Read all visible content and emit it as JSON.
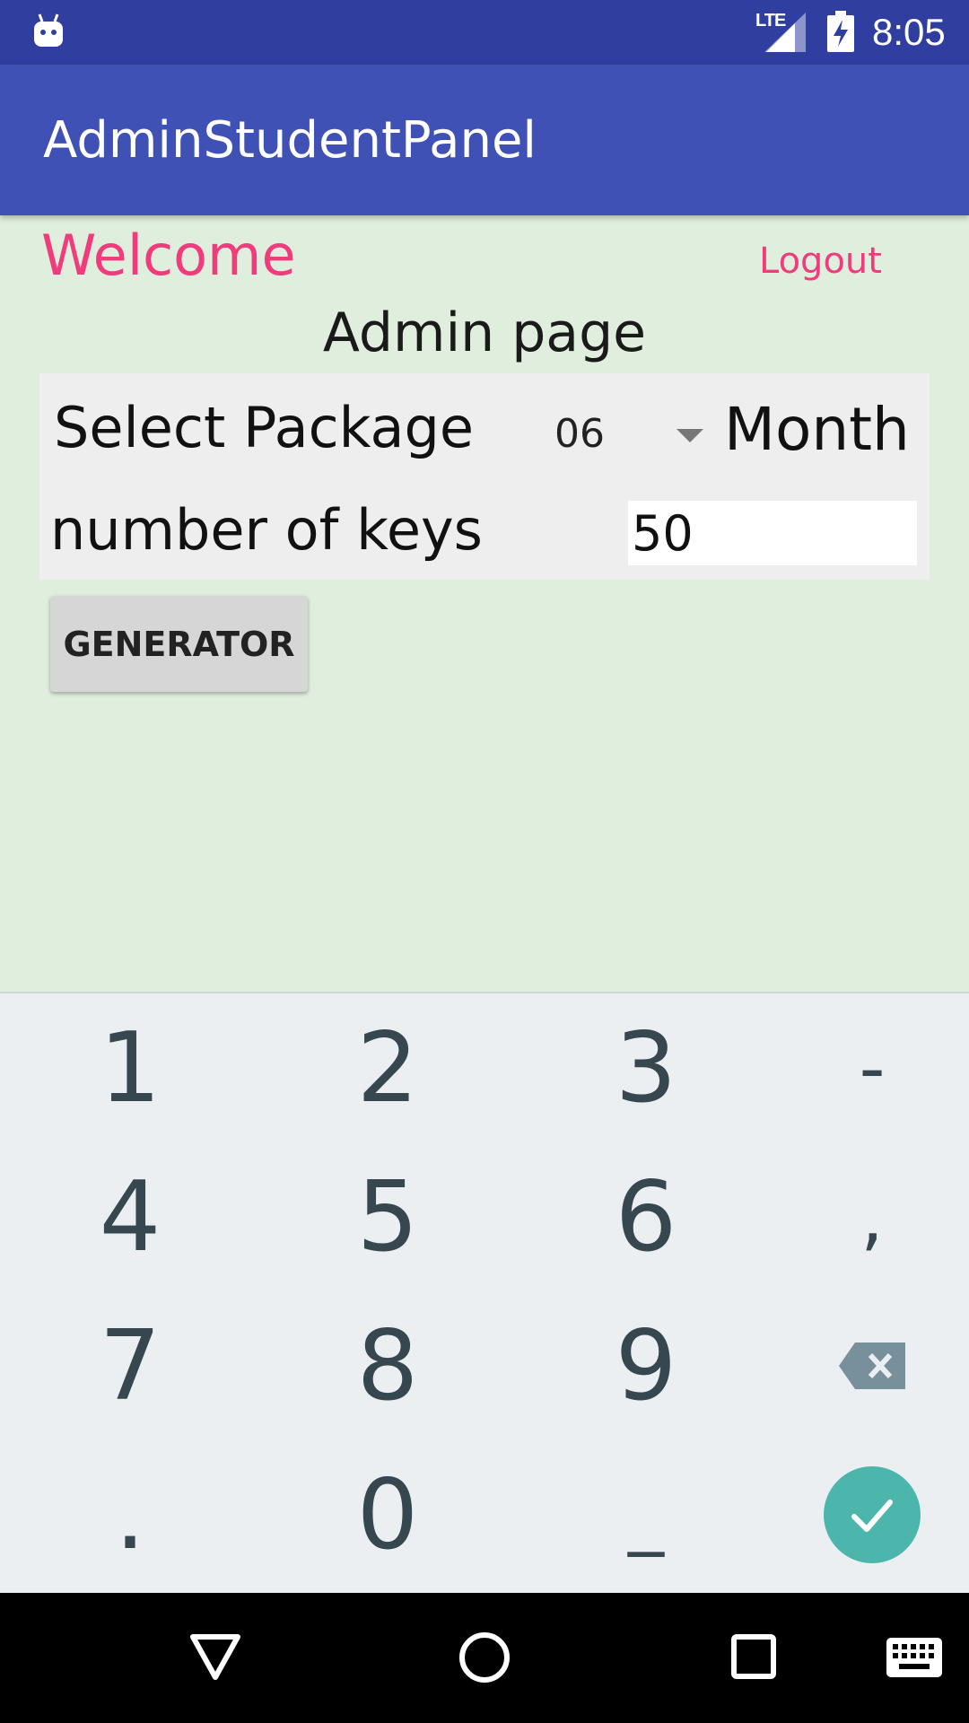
{
  "status_bar": {
    "network_label": "LTE",
    "time": "8:05",
    "icons": [
      "android-debug-icon",
      "signal-icon",
      "battery-charging-icon"
    ]
  },
  "app_bar": {
    "title": "AdminStudentPanel"
  },
  "content": {
    "welcome": "Welcome",
    "logout": "Logout",
    "page_title": "Admin page",
    "select_package_label": "Select Package",
    "package_value": "06",
    "package_unit": "Month",
    "keys_label": "number of keys",
    "keys_value": "50",
    "generator_button": "GENERATOR"
  },
  "keyboard": {
    "row1": [
      "1",
      "2",
      "3",
      "-"
    ],
    "row2": [
      "4",
      "5",
      "6",
      ","
    ],
    "row3": [
      "7",
      "8",
      "9"
    ],
    "row4": [
      ".",
      "0",
      "_"
    ],
    "icons": [
      "backspace-icon",
      "done-check-icon"
    ]
  },
  "nav_bar": {
    "icons": [
      "back-icon",
      "home-icon",
      "recents-icon",
      "keyboard-switch-icon"
    ]
  },
  "colors": {
    "status_bar": "#303f9f",
    "app_bar": "#3f51b5",
    "accent": "#f03c7c",
    "background": "#dfeedd",
    "keyboard": "#eceff1",
    "done_button": "#4db6ac"
  }
}
